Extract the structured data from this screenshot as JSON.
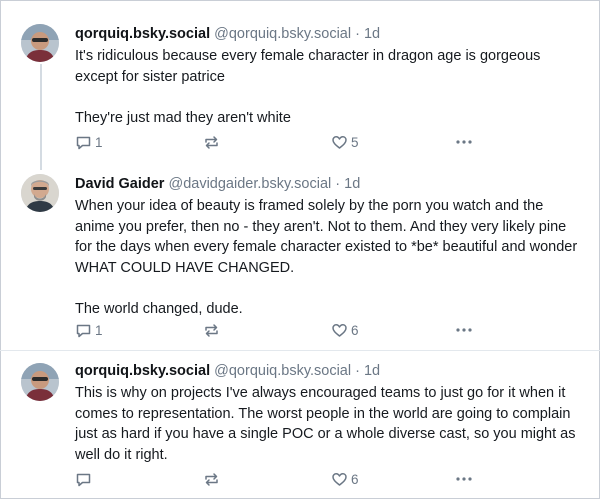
{
  "posts": [
    {
      "author": "qorquiq.bsky.social",
      "handle": "@qorquiq.bsky.social",
      "time": "· 1d",
      "body": [
        "It's ridiculous because every female character in dragon age is gorgeous except for sister patrice",
        "They're just mad they aren't white"
      ],
      "replies": "1",
      "reposts": "",
      "likes": "5"
    },
    {
      "author": "David Gaider",
      "handle": "@davidgaider.bsky.social",
      "time": "· 1d",
      "body": [
        "When your idea of beauty is framed solely by the porn you watch and the anime you prefer, then no - they aren't. Not to them. And they very likely pine for the days when every female character existed to *be* beautiful and wonder WHAT COULD HAVE CHANGED.",
        "The world changed, dude."
      ],
      "replies": "1",
      "reposts": "",
      "likes": "6"
    },
    {
      "author": "qorquiq.bsky.social",
      "handle": "@qorquiq.bsky.social",
      "time": "· 1d",
      "body": [
        "This is why on projects I've always encouraged teams to just go for it when it comes to representation. The worst people in the world are going to complain just as hard if you have a single POC or a whole diverse cast, so you might as well do it right."
      ],
      "replies": "",
      "reposts": "",
      "likes": "6"
    }
  ],
  "icons": {
    "reply": "reply-icon",
    "repost": "repost-icon",
    "like": "heart-icon",
    "more": "more-options-icon"
  },
  "colors": {
    "text": "#161a1f",
    "muted": "#6b7785",
    "thread_line": "#d4dbe2"
  }
}
